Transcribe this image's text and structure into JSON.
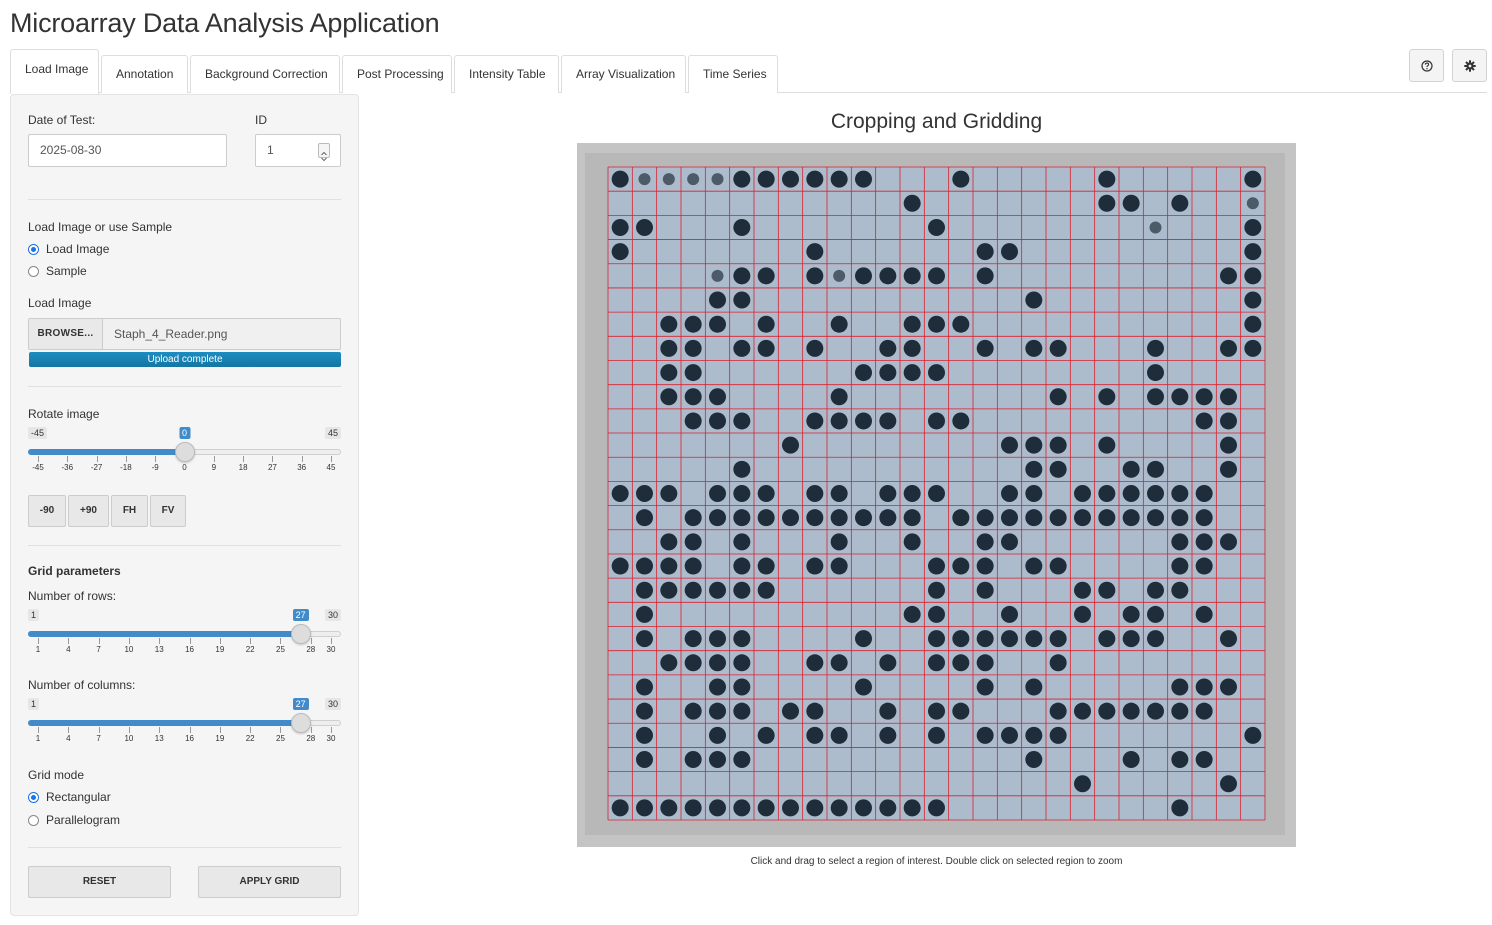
{
  "app": {
    "title": "Microarray Data Analysis Application"
  },
  "tabs": [
    {
      "label": "Load Image",
      "active": true
    },
    {
      "label": "Annotation"
    },
    {
      "label": "Background Correction"
    },
    {
      "label": "Post Processing"
    },
    {
      "label": "Intensity Table"
    },
    {
      "label": "Array Visualization"
    },
    {
      "label": "Time Series"
    }
  ],
  "toolbar": {
    "help_icon": "question-circle-icon",
    "settings_icon": "gear-icon"
  },
  "sidebar": {
    "date_label": "Date of Test:",
    "date_value": "2025-08-30",
    "id_label": "ID",
    "id_value": "1",
    "source_label": "Load Image or use Sample",
    "source_options": [
      "Load Image",
      "Sample"
    ],
    "source_selected": "Load Image",
    "file_label": "Load Image",
    "browse_label": "BROWSE...",
    "file_name": "Staph_4_Reader.png",
    "upload_status": "Upload complete",
    "upload_progress": 1.0,
    "rotate": {
      "label": "Rotate image",
      "min": "-45",
      "max": "45",
      "value": "0",
      "ticks": [
        "-45",
        "-36",
        "-27",
        "-18",
        "-9",
        "0",
        "9",
        "18",
        "27",
        "36",
        "45"
      ]
    },
    "rotate_buttons": [
      "-90",
      "+90",
      "FH",
      "FV"
    ],
    "grid_header": "Grid parameters",
    "rows": {
      "label": "Number of rows:",
      "min": "1",
      "max": "30",
      "value": "27",
      "ticks": [
        "1",
        "4",
        "7",
        "10",
        "13",
        "16",
        "19",
        "22",
        "25",
        "28",
        "30"
      ]
    },
    "cols": {
      "label": "Number of columns:",
      "min": "1",
      "max": "30",
      "value": "27",
      "ticks": [
        "1",
        "4",
        "7",
        "10",
        "13",
        "16",
        "19",
        "22",
        "25",
        "28",
        "30"
      ]
    },
    "grid_mode_label": "Grid mode",
    "grid_modes": [
      "Rectangular",
      "Parallelogram"
    ],
    "grid_mode_selected": "Rectangular",
    "reset_label": "RESET",
    "apply_label": "APPLY GRID"
  },
  "main": {
    "title": "Cropping and Gridding",
    "caption": "Click and drag to select a region of interest. Double click on selected region to zoom"
  },
  "colors": {
    "accent": "#428bca",
    "progress": "#1576a3",
    "grid_line": "#d9202f",
    "image_bg": "#adbccd"
  }
}
